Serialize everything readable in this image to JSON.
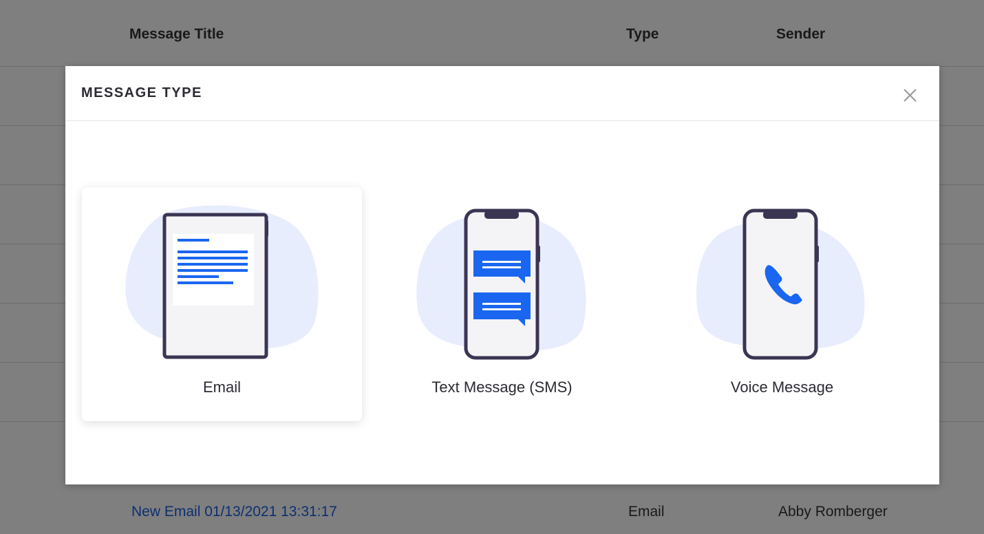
{
  "table": {
    "columns": [
      "Message Title",
      "Type",
      "Sender"
    ],
    "row": {
      "title": "New Email 01/13/2021 13:31:17",
      "type": "Email",
      "sender": "Abby Romberger"
    }
  },
  "modal": {
    "title": "MESSAGE TYPE",
    "options": [
      {
        "label": "Email",
        "icon": "tablet-document-icon",
        "selected": true
      },
      {
        "label": "Text Message (SMS)",
        "icon": "phone-chat-icon",
        "selected": false
      },
      {
        "label": "Voice Message",
        "icon": "phone-call-icon",
        "selected": false
      }
    ]
  },
  "colors": {
    "accent": "#1a66f0",
    "blob": "#e8edfd",
    "device": "#3a3552",
    "link": "#1a5ee0"
  }
}
